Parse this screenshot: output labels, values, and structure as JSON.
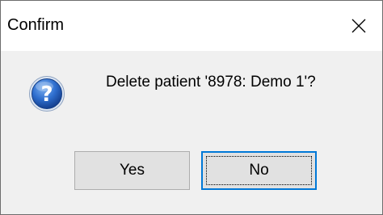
{
  "window": {
    "title": "Confirm",
    "close_icon": "close-icon"
  },
  "dialog": {
    "icon": "question-icon",
    "message": "Delete patient '8978: Demo 1'?"
  },
  "buttons": {
    "yes_label": "Yes",
    "no_label": "No",
    "default": "No"
  },
  "colors": {
    "titlebar_bg": "#ffffff",
    "body_bg": "#f0f0f0",
    "button_bg": "#e1e1e1",
    "focus_border": "#0078d7",
    "icon_blue": "#1f5fbf"
  }
}
